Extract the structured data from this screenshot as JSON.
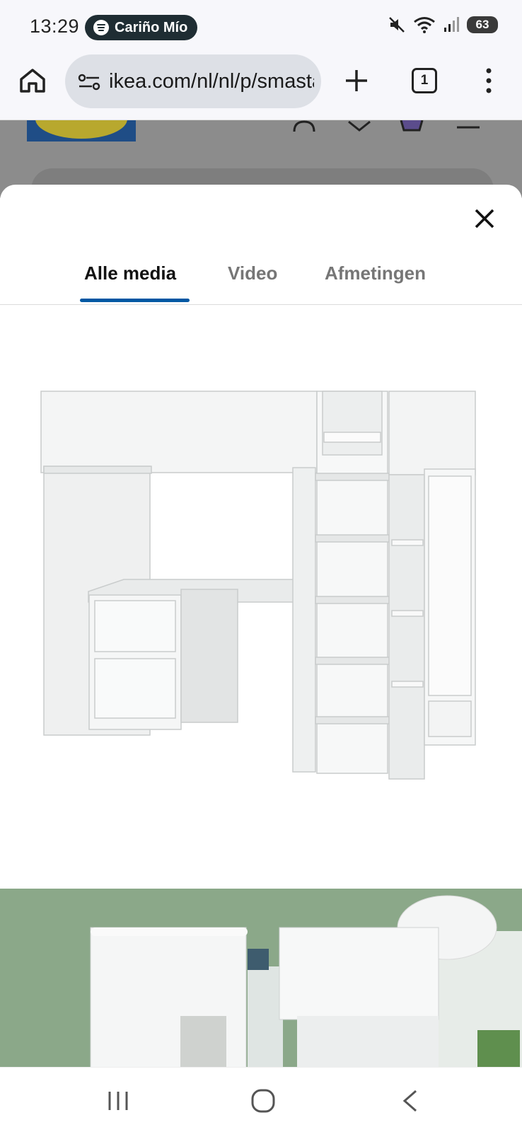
{
  "status_bar": {
    "time": "13:29",
    "media_title": "Cariño Mío",
    "battery": "63",
    "icons": [
      "mute-icon",
      "wifi-icon",
      "signal-icon",
      "battery-icon"
    ]
  },
  "browser": {
    "url": "ikea.com/nl/nl/p/smastad",
    "tab_count": "1",
    "icons": [
      "home-icon",
      "site-settings-icon",
      "new-tab-icon",
      "tab-switcher-icon",
      "overflow-menu-icon"
    ]
  },
  "modal": {
    "tabs": [
      {
        "label": "Alle media",
        "active": true
      },
      {
        "label": "Video",
        "active": false
      },
      {
        "label": "Afmetingen",
        "active": false
      }
    ],
    "accent_color": "#0058a3",
    "images": [
      "loft-bed-desk-wardrobe-product",
      "loft-bed-room-scene"
    ]
  },
  "nav": {
    "icons": [
      "recent-apps-icon",
      "home-circle-icon",
      "back-icon"
    ]
  }
}
